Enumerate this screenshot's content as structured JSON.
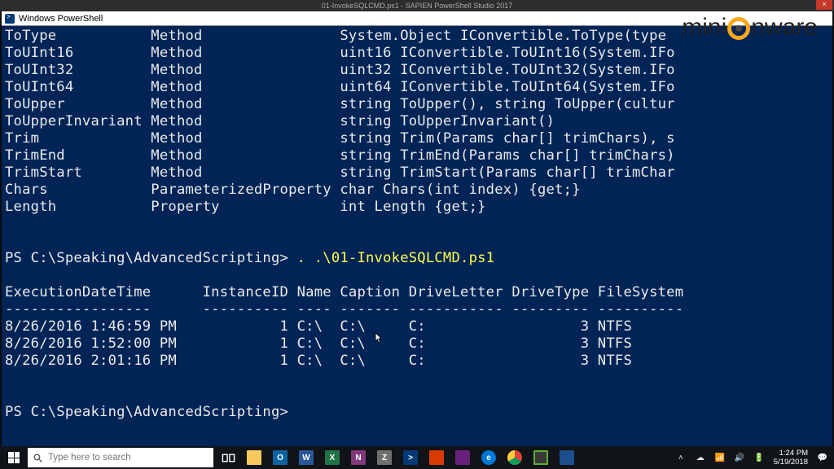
{
  "ide": {
    "title": "01-InvokeSQLCMD.ps1 - SAPIEN PowerShell Studio 2017"
  },
  "logo": {
    "pre": "mini",
    "post": "nware"
  },
  "ps_window": {
    "title": "Windows PowerShell"
  },
  "members": [
    {
      "name": "ToType",
      "type": "Method",
      "def": "System.Object IConvertible.ToType(type"
    },
    {
      "name": "ToUInt16",
      "type": "Method",
      "def": "uint16 IConvertible.ToUInt16(System.IFo"
    },
    {
      "name": "ToUInt32",
      "type": "Method",
      "def": "uint32 IConvertible.ToUInt32(System.IFo"
    },
    {
      "name": "ToUInt64",
      "type": "Method",
      "def": "uint64 IConvertible.ToUInt64(System.IFo"
    },
    {
      "name": "ToUpper",
      "type": "Method",
      "def": "string ToUpper(), string ToUpper(cultur"
    },
    {
      "name": "ToUpperInvariant",
      "type": "Method",
      "def": "string ToUpperInvariant()"
    },
    {
      "name": "Trim",
      "type": "Method",
      "def": "string Trim(Params char[] trimChars), s"
    },
    {
      "name": "TrimEnd",
      "type": "Method",
      "def": "string TrimEnd(Params char[] trimChars)"
    },
    {
      "name": "TrimStart",
      "type": "Method",
      "def": "string TrimStart(Params char[] trimChar"
    },
    {
      "name": "Chars",
      "type": "ParameterizedProperty",
      "def": "char Chars(int index) {get;}"
    },
    {
      "name": "Length",
      "type": "Property",
      "def": "int Length {get;}"
    }
  ],
  "prompt1": {
    "path": "PS C:\\Speaking\\AdvancedScripting>",
    "cmd": ". .\\01-InvokeSQLCMD.ps1"
  },
  "table": {
    "headers": [
      "ExecutionDateTime",
      "InstanceID",
      "Name",
      "Caption",
      "DriveLetter",
      "DriveType",
      "FileSystem"
    ],
    "rows": [
      [
        "8/26/2016 1:46:59 PM",
        "1",
        "C:\\",
        "C:\\",
        "C:",
        "3",
        "NTFS"
      ],
      [
        "8/26/2016 1:52:00 PM",
        "1",
        "C:\\",
        "C:\\",
        "C:",
        "3",
        "NTFS"
      ],
      [
        "8/26/2016 2:01:16 PM",
        "1",
        "C:\\",
        "C:\\",
        "C:",
        "3",
        "NTFS"
      ]
    ]
  },
  "prompt2": {
    "path": "PS C:\\Speaking\\AdvancedScripting>"
  },
  "taskbar": {
    "search_placeholder": "Type here to search",
    "clock_time": "1:24 PM",
    "clock_date": "5/19/2018"
  },
  "chart_data": {
    "type": "table",
    "title": "Drive query output",
    "columns": [
      "ExecutionDateTime",
      "InstanceID",
      "Name",
      "Caption",
      "DriveLetter",
      "DriveType",
      "FileSystem"
    ],
    "rows": [
      [
        "8/26/2016 1:46:59 PM",
        1,
        "C:\\",
        "C:\\",
        "C:",
        3,
        "NTFS"
      ],
      [
        "8/26/2016 1:52:00 PM",
        1,
        "C:\\",
        "C:\\",
        "C:",
        3,
        "NTFS"
      ],
      [
        "8/26/2016 2:01:16 PM",
        1,
        "C:\\",
        "C:\\",
        "C:",
        3,
        "NTFS"
      ]
    ]
  }
}
